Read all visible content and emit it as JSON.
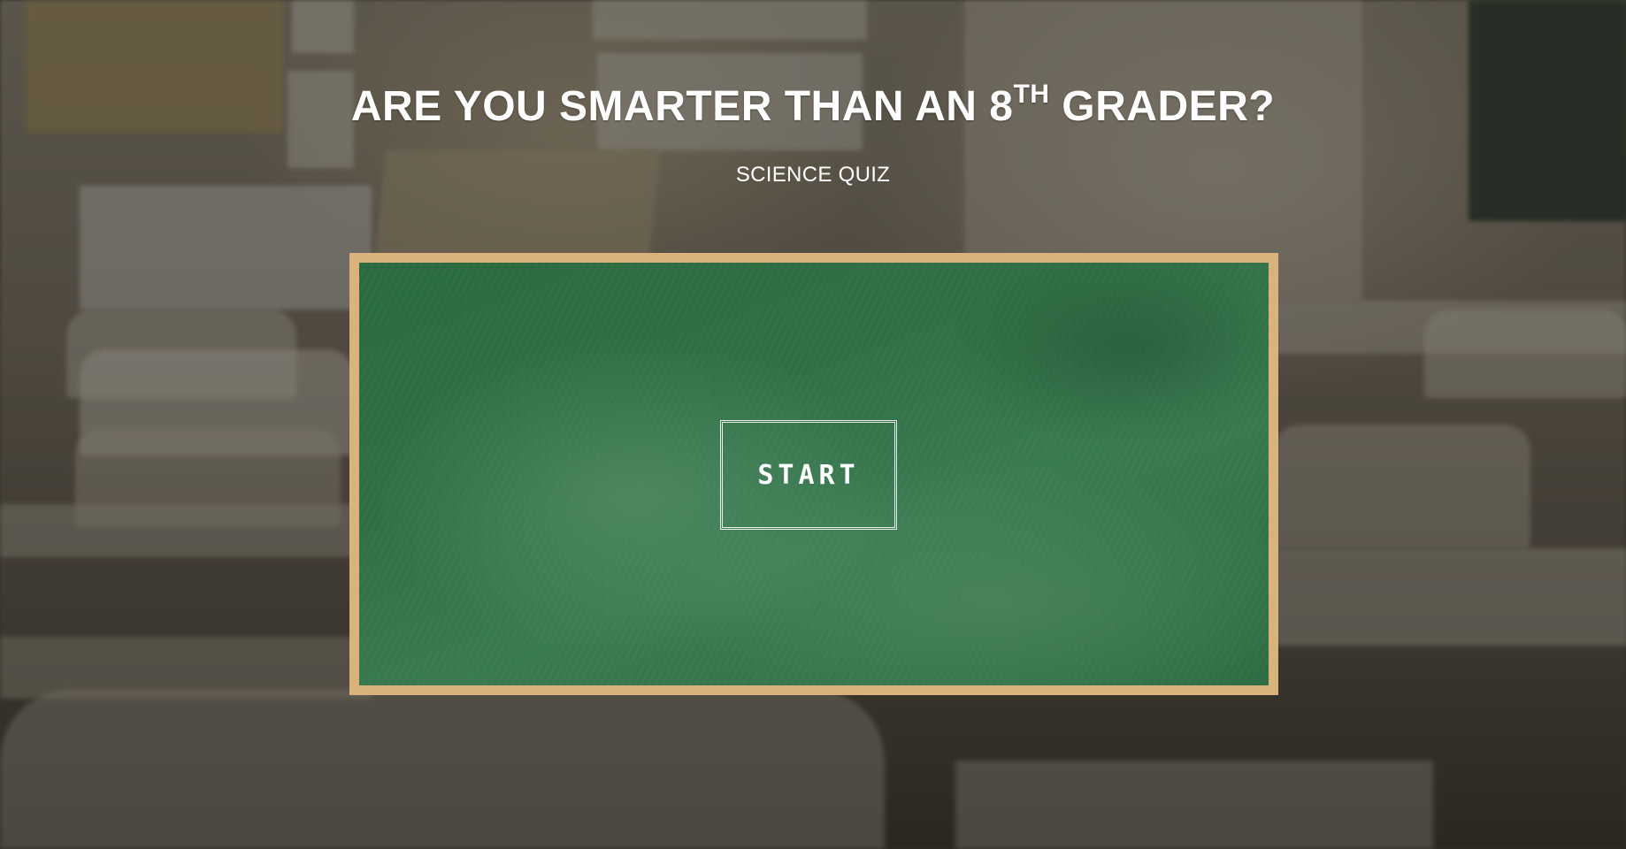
{
  "header": {
    "title_main": "ARE YOU SMARTER THAN AN 8",
    "title_sup": "TH",
    "title_end": " GRADER?",
    "subtitle": "SCIENCE QUIZ"
  },
  "board": {
    "start_label": "START"
  },
  "colors": {
    "frame": "#d9b27c",
    "chalkboard": "#306f45",
    "text": "#ffffff"
  }
}
